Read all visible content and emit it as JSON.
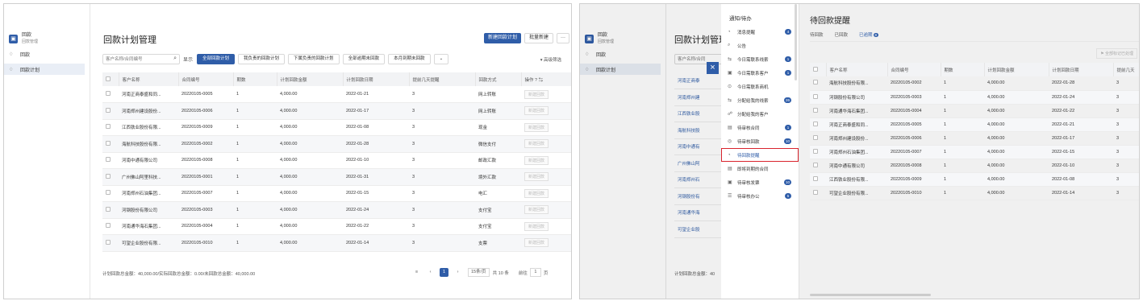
{
  "nav": {
    "app_title": "回款",
    "app_sub": "回款管理",
    "items": [
      {
        "label": "回款"
      },
      {
        "label": "回款计划"
      }
    ]
  },
  "left": {
    "page_title": "回款计划管理",
    "new_button": "新建回款计划",
    "batch_button": "批量新建",
    "more_button": "···",
    "search_placeholder": "客户名称/合同编号",
    "show_label": "显示",
    "filters": [
      "全部回款计划",
      "我负责的回款计划",
      "下属负责的回款计划",
      "全部逾期未回款",
      "本月到期未回款"
    ],
    "advanced": "高级筛选",
    "columns": [
      "客户名称",
      "合同编号",
      "期数",
      "计划回款金额",
      "计划回款日期",
      "提前几天提醒",
      "回款方式",
      "操作"
    ],
    "rows": [
      {
        "customer": "河南正商泰盛和同...",
        "contract": "20220105-0005",
        "period": "1",
        "amount": "4,000.00",
        "date": "2022-01-21",
        "remind": "3",
        "method": "网上转账",
        "op": "新建回款"
      },
      {
        "customer": "河南郑州建设股份...",
        "contract": "20220105-0006",
        "period": "1",
        "amount": "4,000.00",
        "date": "2022-01-17",
        "remind": "3",
        "method": "网上转账",
        "op": "新建回款"
      },
      {
        "customer": "江西铁业股份有限...",
        "contract": "20220105-0009",
        "period": "1",
        "amount": "4,000.00",
        "date": "2022-01-08",
        "remind": "3",
        "method": "现金",
        "op": "新建回款"
      },
      {
        "customer": "海航科技股份有限...",
        "contract": "20220105-0002",
        "period": "1",
        "amount": "4,000.00",
        "date": "2022-01-28",
        "remind": "3",
        "method": "微信支付",
        "op": "新建回款"
      },
      {
        "customer": "河南中通有限公司",
        "contract": "20220105-0008",
        "period": "1",
        "amount": "4,000.00",
        "date": "2022-01-10",
        "remind": "3",
        "method": "邮政汇款",
        "op": "新建回款"
      },
      {
        "customer": "广州佛山阿里科技...",
        "contract": "20220105-0001",
        "period": "1",
        "amount": "4,000.00",
        "date": "2022-01-31",
        "remind": "3",
        "method": "境外汇款",
        "op": "新建回款"
      },
      {
        "customer": "河南郑州石油集团...",
        "contract": "20220105-0007",
        "period": "1",
        "amount": "4,000.00",
        "date": "2022-01-15",
        "remind": "3",
        "method": "电汇",
        "op": "新建回款"
      },
      {
        "customer": "河钢股份有限公司",
        "contract": "20220105-0003",
        "period": "1",
        "amount": "4,000.00",
        "date": "2022-01-24",
        "remind": "3",
        "method": "支付宝",
        "op": "新建回款"
      },
      {
        "customer": "河南通华海石集团...",
        "contract": "20220105-0004",
        "period": "1",
        "amount": "4,000.00",
        "date": "2022-01-22",
        "remind": "3",
        "method": "支付宝",
        "op": "新建回款"
      },
      {
        "customer": "可望企业股份有限...",
        "contract": "20220105-0010",
        "period": "1",
        "amount": "4,000.00",
        "date": "2022-01-14",
        "remind": "3",
        "method": "支票",
        "op": "新建回款"
      }
    ],
    "summary": "计划回款总金额：40,000.00/实际回款总金额：0.00/未回款总金额：40,000.00",
    "pager": {
      "page": "1",
      "page_size": "15条/页",
      "total": "共 10 条",
      "goto_label": "前往",
      "goto_value": "1",
      "page_suffix": "页"
    }
  },
  "right": {
    "bg_title": "回款计划管理",
    "bg_search_placeholder": "客户名称/合同",
    "bg_rows": [
      "河南正商泰",
      "河南郑州建",
      "江西铁业股",
      "海航科技股",
      "河南中通有",
      "广州佛山阿",
      "河南郑州石",
      "河钢股份有",
      "河南通华海",
      "可望企业股"
    ],
    "bg_summary": "计划回款总金额：40",
    "close": "×",
    "drawer_title": "通知/待办",
    "drawer_items": [
      {
        "label": "消息提醒",
        "icon": "◔",
        "badge": "4"
      },
      {
        "label": "公告",
        "icon": "⌕",
        "badge": ""
      },
      {
        "label": "今日需联系线索",
        "icon": "⇆",
        "badge": "1"
      },
      {
        "label": "今日需联系客户",
        "icon": "▣",
        "badge": "1"
      },
      {
        "label": "今日需联系商机",
        "icon": "⊙",
        "badge": ""
      },
      {
        "label": "分配给我的线索",
        "icon": "⇆",
        "badge": "26"
      },
      {
        "label": "分配给我的客户",
        "icon": "☍",
        "badge": ""
      },
      {
        "label": "待审核合同",
        "icon": "▤",
        "badge": "1"
      },
      {
        "label": "待审核回款",
        "icon": "◎",
        "badge": "10"
      },
      {
        "label": "待回款提醒",
        "icon": "◔",
        "badge": ""
      },
      {
        "label": "即将到期的合同",
        "icon": "▤",
        "badge": ""
      },
      {
        "label": "待审核发票",
        "icon": "▣",
        "badge": "10"
      },
      {
        "label": "待审核办公",
        "icon": "☰",
        "badge": "5"
      }
    ],
    "content_title": "待回款提醒",
    "tabs": [
      {
        "label": "待回款",
        "badge": ""
      },
      {
        "label": "已回款",
        "badge": ""
      },
      {
        "label": "已逾期",
        "badge": "8"
      }
    ],
    "mark_button": "全部标记已处理",
    "columns": [
      "客户名称",
      "合同编号",
      "期数",
      "计划回款金额",
      "计划回款日期",
      "提前几天"
    ],
    "rows": [
      {
        "customer": "海航科技股份有限...",
        "contract": "20220105-0002",
        "period": "1",
        "amount": "4,000.00",
        "date": "2022-01-28",
        "remind": "3"
      },
      {
        "customer": "河钢股份有限公司",
        "contract": "20220105-0003",
        "period": "1",
        "amount": "4,000.00",
        "date": "2022-01-24",
        "remind": "3"
      },
      {
        "customer": "河南通华海石集团...",
        "contract": "20220105-0004",
        "period": "1",
        "amount": "4,000.00",
        "date": "2022-01-22",
        "remind": "3"
      },
      {
        "customer": "河南正商泰盛和同...",
        "contract": "20220105-0005",
        "period": "1",
        "amount": "4,000.00",
        "date": "2022-01-21",
        "remind": "3"
      },
      {
        "customer": "河南郑州建设股份...",
        "contract": "20220105-0006",
        "period": "1",
        "amount": "4,000.00",
        "date": "2022-01-17",
        "remind": "3"
      },
      {
        "customer": "河南郑州石油集团...",
        "contract": "20220105-0007",
        "period": "1",
        "amount": "4,000.00",
        "date": "2022-01-15",
        "remind": "3"
      },
      {
        "customer": "河南中通有限公司",
        "contract": "20220105-0008",
        "period": "1",
        "amount": "4,000.00",
        "date": "2022-01-10",
        "remind": "3"
      },
      {
        "customer": "江西铁业股份有限...",
        "contract": "20220105-0009",
        "period": "1",
        "amount": "4,000.00",
        "date": "2022-01-08",
        "remind": "3"
      },
      {
        "customer": "可望企业股份有限...",
        "contract": "20220105-0010",
        "period": "1",
        "amount": "4,000.00",
        "date": "2022-01-14",
        "remind": "3"
      }
    ]
  },
  "colors": {
    "primary": "#2f5da8",
    "amount": "#f08c00",
    "highlight_box": "#d9232d"
  }
}
